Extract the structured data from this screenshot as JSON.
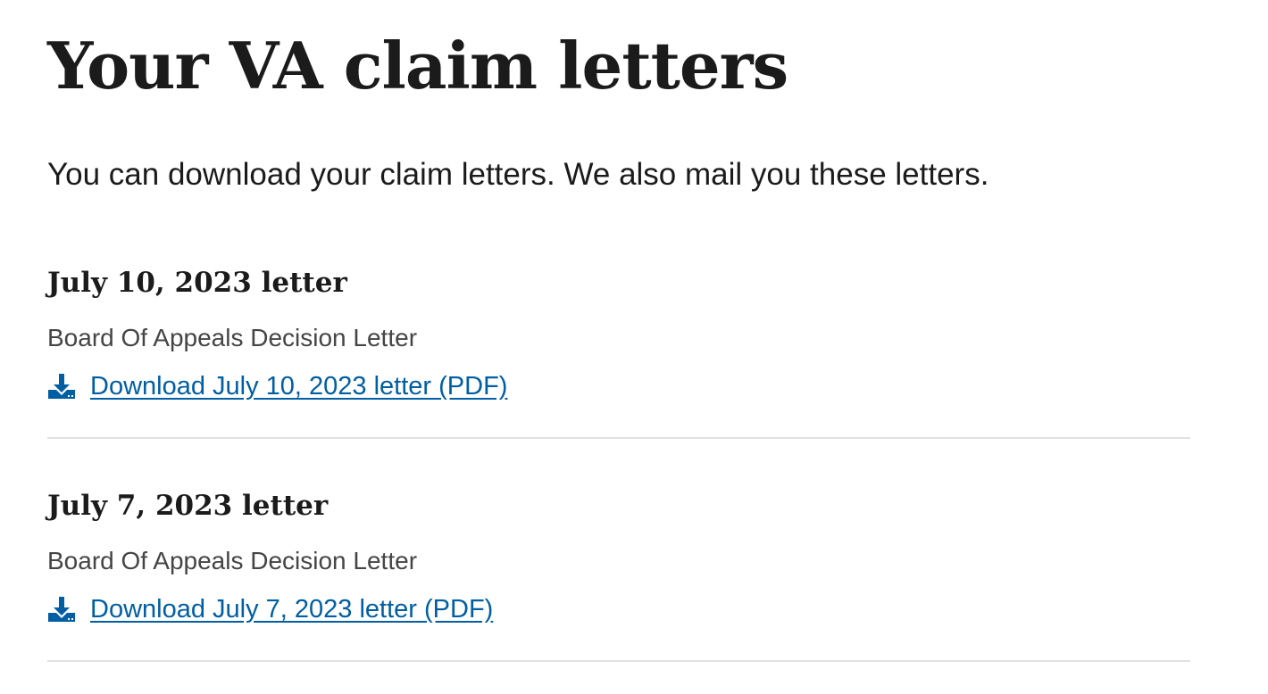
{
  "page": {
    "title": "Your VA claim letters",
    "intro": "You can download your claim letters. We also mail you these letters."
  },
  "letters": [
    {
      "heading": "July 10, 2023 letter",
      "type": "Board Of Appeals Decision Letter",
      "download_label": "Download July 10, 2023 letter (PDF)",
      "icon": "download-icon"
    },
    {
      "heading": "July 7, 2023 letter",
      "type": "Board Of Appeals Decision Letter",
      "download_label": "Download July 7, 2023 letter (PDF)",
      "icon": "download-icon"
    }
  ],
  "colors": {
    "link": "#005ea2",
    "text": "#1b1b1b",
    "secondary_text": "#454545",
    "divider": "#dfe1e2"
  }
}
